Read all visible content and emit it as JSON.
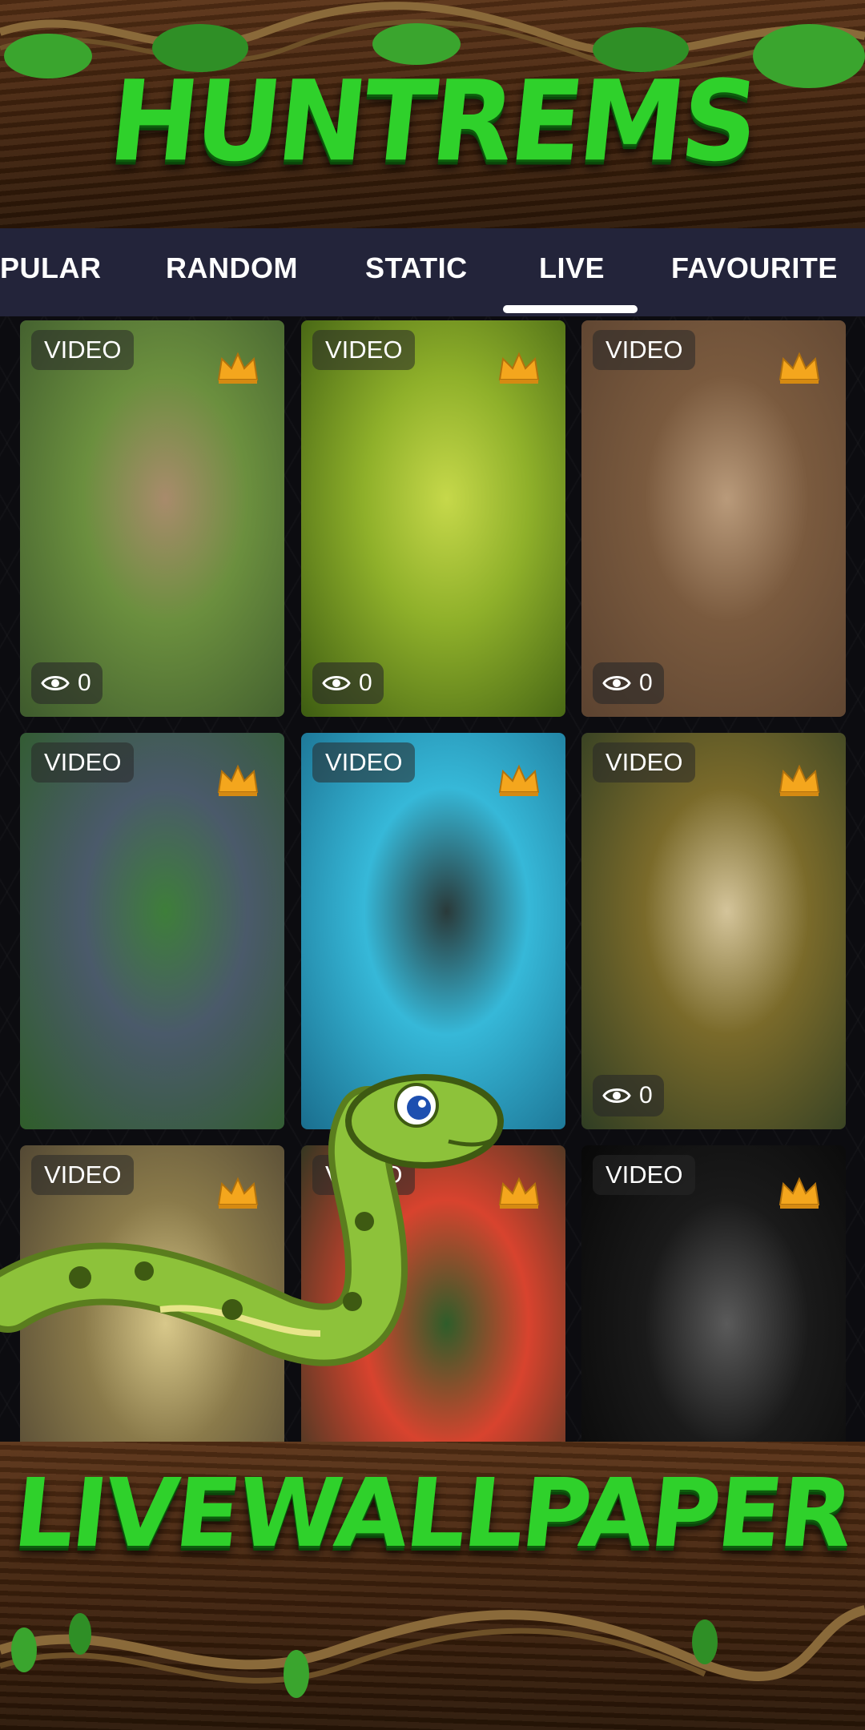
{
  "header": {
    "title": "HUNTREMS"
  },
  "tabs": [
    {
      "label": "PULAR",
      "active": false
    },
    {
      "label": "RANDOM",
      "active": false
    },
    {
      "label": "STATIC",
      "active": false
    },
    {
      "label": "LIVE",
      "active": true
    },
    {
      "label": "FAVOURITE",
      "active": false
    }
  ],
  "grid": {
    "items": [
      {
        "badge": "VIDEO",
        "premium": true,
        "views": "0",
        "palette": [
          "#3e5a2d",
          "#6b8f3e",
          "#a88b6b"
        ]
      },
      {
        "badge": "VIDEO",
        "premium": true,
        "views": "0",
        "palette": [
          "#3d5c12",
          "#8fb02a",
          "#c6d84a"
        ]
      },
      {
        "badge": "VIDEO",
        "premium": true,
        "views": "0",
        "palette": [
          "#5c4330",
          "#7a5a3e",
          "#b99a7a"
        ]
      },
      {
        "badge": "VIDEO",
        "premium": true,
        "views": "",
        "palette": [
          "#2f5d2a",
          "#4a5a6a",
          "#3e7e3a"
        ]
      },
      {
        "badge": "VIDEO",
        "premium": true,
        "views": "",
        "palette": [
          "#1a6e8e",
          "#36b8d8",
          "#2a3a3a"
        ]
      },
      {
        "badge": "VIDEO",
        "premium": true,
        "views": "0",
        "palette": [
          "#2f3d23",
          "#7a6a2a",
          "#d4c49a"
        ]
      },
      {
        "badge": "VIDEO",
        "premium": true,
        "views": "",
        "palette": [
          "#4a4030",
          "#8a7a4a",
          "#d8c88a"
        ]
      },
      {
        "badge": "VIDEO",
        "premium": true,
        "views": "",
        "palette": [
          "#1a3520",
          "#d8432e",
          "#2f5d2a"
        ]
      },
      {
        "badge": "VIDEO",
        "premium": true,
        "views": "",
        "palette": [
          "#050505",
          "#1a1a1a",
          "#5a5a5a"
        ]
      }
    ]
  },
  "footer": {
    "title": "LIVEWALLPAPER"
  },
  "colors": {
    "accent_green": "#2fd12b",
    "tab_bar": "#23243a",
    "crown": "#f4a61d"
  },
  "icons": {
    "premium": "crown-icon",
    "views": "eye-icon"
  }
}
